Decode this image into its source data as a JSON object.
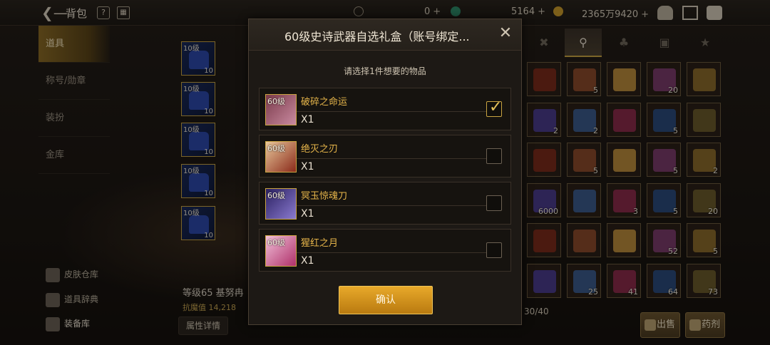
{
  "topbar": {
    "title": "背包",
    "help": "?",
    "currency1_value": "0",
    "currency2_value": "5164",
    "gold_value": "2365万9420",
    "plus": "+"
  },
  "leftnav": {
    "items": [
      {
        "label": "道具"
      },
      {
        "label": "称号/勋章"
      },
      {
        "label": "装扮"
      },
      {
        "label": "金库"
      }
    ],
    "links": [
      {
        "label": "皮肤仓库"
      },
      {
        "label": "道具辞典"
      },
      {
        "label": "装备库"
      }
    ]
  },
  "equipped": [
    {
      "level": "10级",
      "count": "10"
    },
    {
      "level": "10级",
      "count": "10"
    },
    {
      "level": "10级",
      "count": "10"
    },
    {
      "level": "10级",
      "count": "10"
    },
    {
      "level": "10级",
      "count": "10"
    }
  ],
  "character": {
    "name_line": "等级65 基努冉",
    "stat_line": "抗魔值 14,218",
    "attr_button": "属性详情"
  },
  "inventory": {
    "counts": [
      [
        "",
        "5",
        "",
        "20",
        ""
      ],
      [
        "2",
        "2",
        "",
        "5",
        ""
      ],
      [
        "",
        "5",
        "",
        "5",
        "2"
      ],
      [
        "6000",
        "",
        "3",
        "5",
        "20"
      ],
      [
        "",
        "",
        "",
        "52",
        "5"
      ],
      [
        "",
        "25",
        "41",
        "64",
        "73"
      ]
    ],
    "capacity": "30/40",
    "sell_label": "出售",
    "potion_label": "药剂"
  },
  "modal": {
    "title": "60级史诗武器自选礼盒（账号绑定...",
    "close": "✕",
    "subtitle": "请选择1件想要的物品",
    "options": [
      {
        "level": "60级",
        "name": "破碎之命运",
        "qty": "X1",
        "checked": true
      },
      {
        "level": "60级",
        "name": "绝灭之刃",
        "qty": "X1",
        "checked": false
      },
      {
        "level": "60级",
        "name": "冥玉惊魂刀",
        "qty": "X1",
        "checked": false
      },
      {
        "level": "60级",
        "name": "猩红之月",
        "qty": "X1",
        "checked": false
      }
    ],
    "confirm_label": "确认"
  }
}
